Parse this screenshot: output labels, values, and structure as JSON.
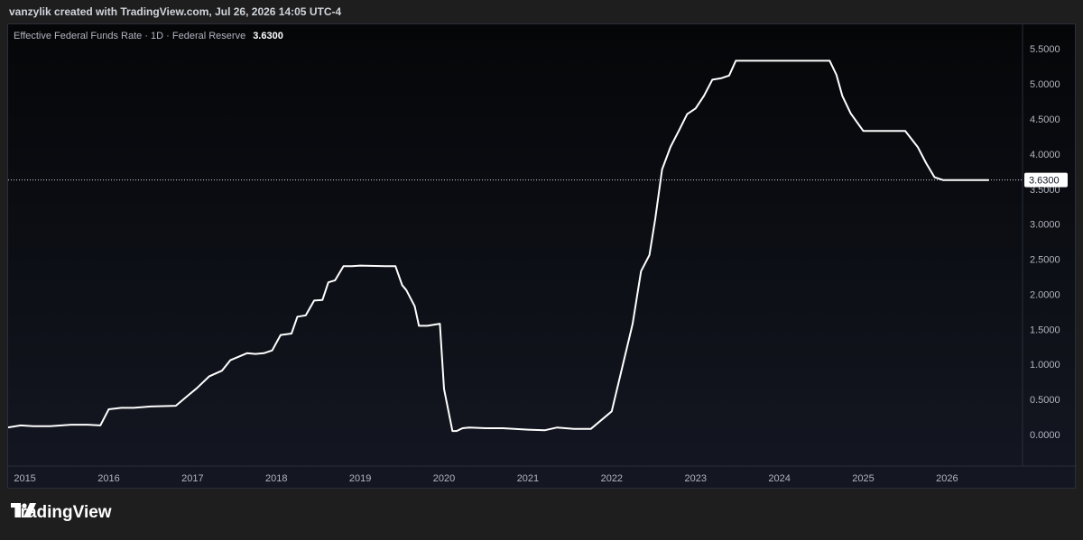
{
  "header": {
    "caption": "vanzylik created with TradingView.com, Jul 26, 2026 14:05 UTC-4"
  },
  "chart_data": {
    "type": "line",
    "title": "Effective Federal Funds Rate · 1D · Federal Reserve",
    "last_value_label": "3.6300",
    "last_value": 3.63,
    "line_color": "#ffffff",
    "ylim": [
      -0.45,
      5.85
    ],
    "xlim": [
      2014.8,
      2026.9
    ],
    "y_ticks": [
      "0.0000",
      "0.5000",
      "1.0000",
      "1.5000",
      "2.0000",
      "2.5000",
      "3.0000",
      "3.5000",
      "4.0000",
      "4.5000",
      "5.0000",
      "5.5000"
    ],
    "x_ticks": [
      "2015",
      "2016",
      "2017",
      "2018",
      "2019",
      "2020",
      "2021",
      "2022",
      "2023",
      "2024",
      "2025",
      "2026"
    ],
    "series": [
      {
        "x": [
          2014.8,
          2014.95,
          2015.1,
          2015.3,
          2015.55,
          2015.75,
          2015.9,
          2016.0,
          2016.15,
          2016.3,
          2016.5,
          2016.8,
          2016.95,
          2017.05,
          2017.2,
          2017.35,
          2017.45,
          2017.65,
          2017.75,
          2017.85,
          2017.95,
          2018.05,
          2018.18,
          2018.25,
          2018.35,
          2018.45,
          2018.55,
          2018.62,
          2018.7,
          2018.8,
          2018.9,
          2019.0,
          2019.3,
          2019.42,
          2019.5,
          2019.55,
          2019.65,
          2019.7,
          2019.8,
          2019.95,
          2020.0,
          2020.1,
          2020.15,
          2020.22,
          2020.3,
          2020.5,
          2020.7,
          2021.0,
          2021.2,
          2021.35,
          2021.55,
          2021.75,
          2022.0,
          2022.1,
          2022.25,
          2022.35,
          2022.45,
          2022.52,
          2022.6,
          2022.7,
          2022.8,
          2022.9,
          2023.0,
          2023.1,
          2023.2,
          2023.3,
          2023.4,
          2023.48,
          2023.6,
          2023.9,
          2024.2,
          2024.6,
          2024.68,
          2024.75,
          2024.85,
          2025.0,
          2025.15,
          2025.3,
          2025.5,
          2025.65,
          2025.75,
          2025.85,
          2025.95,
          2026.05,
          2026.3,
          2026.5
        ],
        "values": [
          0.1,
          0.13,
          0.12,
          0.12,
          0.14,
          0.14,
          0.13,
          0.36,
          0.38,
          0.38,
          0.4,
          0.41,
          0.56,
          0.66,
          0.83,
          0.91,
          1.06,
          1.16,
          1.15,
          1.16,
          1.2,
          1.42,
          1.44,
          1.68,
          1.7,
          1.91,
          1.92,
          2.17,
          2.2,
          2.4,
          2.4,
          2.41,
          2.4,
          2.4,
          2.13,
          2.06,
          1.83,
          1.55,
          1.55,
          1.58,
          0.65,
          0.05,
          0.05,
          0.09,
          0.1,
          0.09,
          0.09,
          0.07,
          0.06,
          0.1,
          0.08,
          0.08,
          0.33,
          0.83,
          1.58,
          2.33,
          2.56,
          3.08,
          3.78,
          4.1,
          4.33,
          4.57,
          4.65,
          4.83,
          5.06,
          5.08,
          5.12,
          5.33,
          5.33,
          5.33,
          5.33,
          5.33,
          5.13,
          4.83,
          4.58,
          4.33,
          4.33,
          4.33,
          4.33,
          4.1,
          3.87,
          3.67,
          3.63,
          3.63,
          3.63,
          3.63
        ]
      }
    ]
  },
  "brand": {
    "name": "TradingView"
  }
}
